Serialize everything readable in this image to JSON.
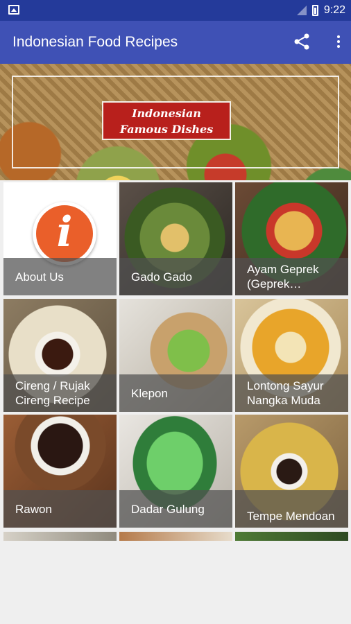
{
  "status_bar": {
    "time": "9:22"
  },
  "app_bar": {
    "title": "Indonesian Food Recipes"
  },
  "banner": {
    "line1": "Indonesian",
    "line2": "Famous Dishes"
  },
  "recipes": [
    {
      "label": "About Us"
    },
    {
      "label": "Gado Gado"
    },
    {
      "label": "Ayam Geprek (Geprek…"
    },
    {
      "label": "Cireng / Rujak Cireng Recipe"
    },
    {
      "label": "Klepon"
    },
    {
      "label": "Lontong Sayur Nangka Muda"
    },
    {
      "label": "Rawon"
    },
    {
      "label": "Dadar Gulung"
    },
    {
      "label": "Tempe Mendoan"
    }
  ]
}
